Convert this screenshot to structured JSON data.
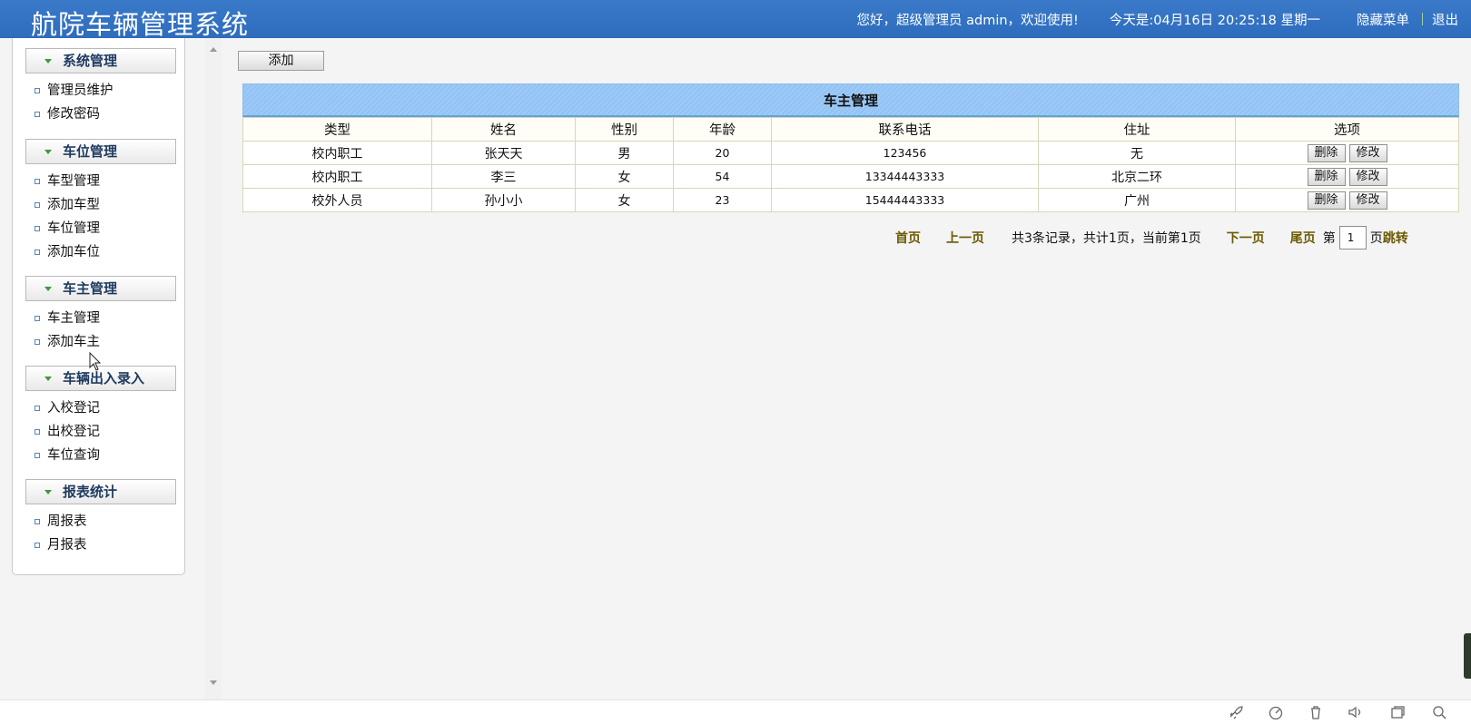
{
  "header": {
    "app_title": "航院车辆管理系统",
    "greeting": "您好，超级管理员 admin，欢迎使用!",
    "date_label": "今天是:04月16日  20:25:18  星期一",
    "hide_menu": "隐藏菜单",
    "logout": "退出"
  },
  "sidebar": {
    "sections": [
      {
        "title": "系统管理",
        "items": [
          "管理员维护",
          "修改密码"
        ]
      },
      {
        "title": "车位管理",
        "items": [
          "车型管理",
          "添加车型",
          "车位管理",
          "添加车位"
        ]
      },
      {
        "title": "车主管理",
        "items": [
          "车主管理",
          "添加车主"
        ]
      },
      {
        "title": "车辆出入录入",
        "items": [
          "入校登记",
          "出校登记",
          "车位查询"
        ]
      },
      {
        "title": "报表统计",
        "items": [
          "周报表",
          "月报表"
        ]
      }
    ]
  },
  "toolbar": {
    "add_label": "添加"
  },
  "table": {
    "caption": "车主管理",
    "headers": [
      "类型",
      "姓名",
      "性别",
      "年龄",
      "联系电话",
      "住址",
      "选项"
    ],
    "rows": [
      [
        "校内职工",
        "张天天",
        "男",
        "20",
        "123456",
        "无"
      ],
      [
        "校内职工",
        "李三",
        "女",
        "54",
        "13344443333",
        "北京二环"
      ],
      [
        "校外人员",
        "孙小小",
        "女",
        "23",
        "15444443333",
        "广州"
      ]
    ],
    "delete_label": "删除",
    "edit_label": "修改"
  },
  "pager": {
    "first": "首页",
    "prev": "上一页",
    "summary": "共3条记录，共计1页，当前第1页",
    "next": "下一页",
    "last": "尾页",
    "goto_prefix": "第",
    "page_value": "1",
    "goto_suffix": "页",
    "jump": "跳转"
  },
  "taskbar": {
    "icons": [
      "rocket-icon",
      "speedometer-icon",
      "trash-icon",
      "speaker-icon",
      "window-icon",
      "search-icon"
    ]
  }
}
